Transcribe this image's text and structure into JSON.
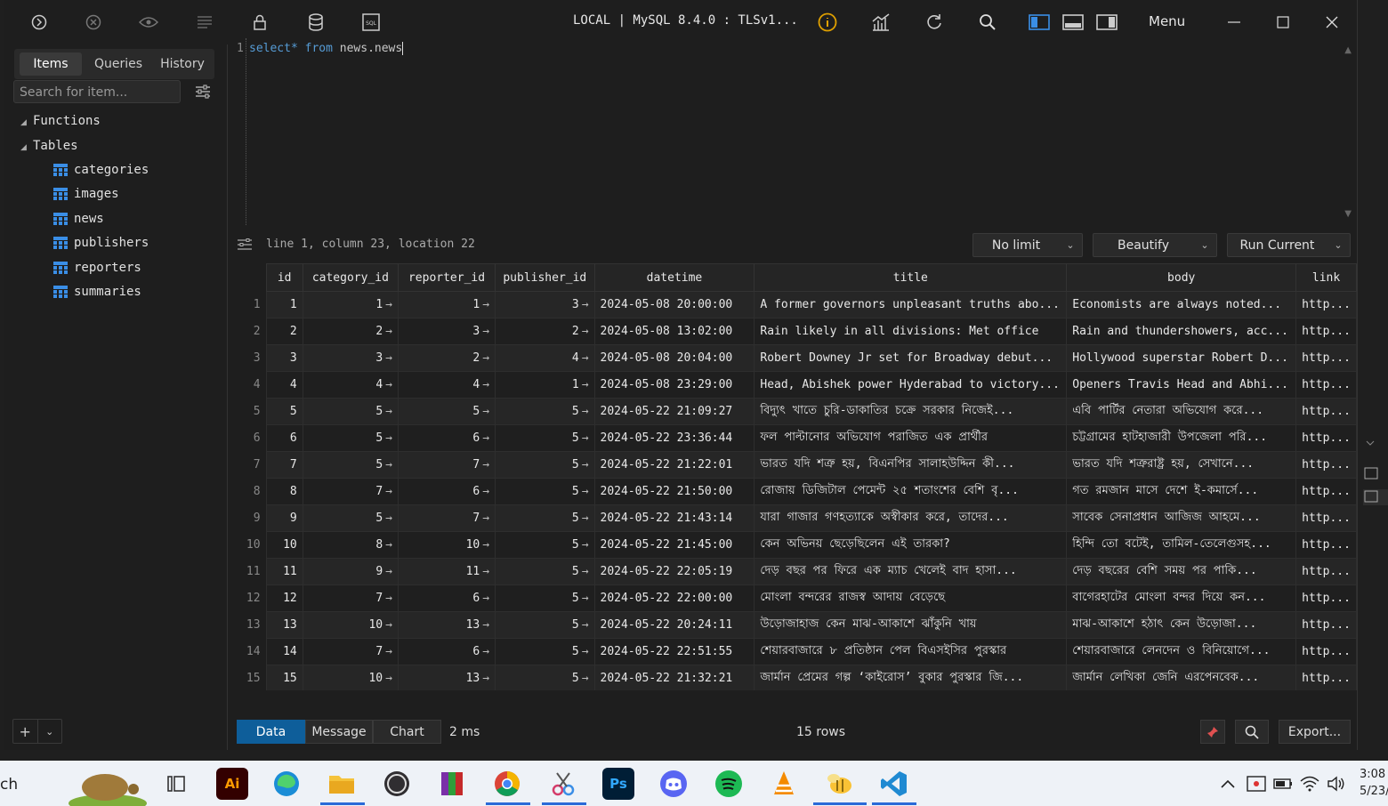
{
  "titlebar": {
    "connection": "LOCAL | MySQL 8.4.0 : TLSv1...",
    "menu_label": "Menu"
  },
  "sidebar": {
    "tabs": [
      "Items",
      "Queries",
      "History"
    ],
    "search_placeholder": "Search for item...",
    "groups": {
      "functions": "Functions",
      "tables": "Tables"
    },
    "tables": [
      "categories",
      "images",
      "news",
      "publishers",
      "reporters",
      "summaries"
    ]
  },
  "editor": {
    "line_number": "1",
    "code_keyword1": "select*",
    "code_keyword2": "from",
    "code_ident": "news.news"
  },
  "status": {
    "position": "line 1, column 23, location 22",
    "limit": "No limit",
    "beautify": "Beautify",
    "run": "Run Current"
  },
  "grid": {
    "columns": [
      "id",
      "category_id",
      "reporter_id",
      "publisher_id",
      "datetime",
      "title",
      "body",
      "link"
    ],
    "rows": [
      [
        "1",
        "1",
        "1",
        "3",
        "2024-05-08 20:00:00",
        "A former governors unpleasant truths abo...",
        "Economists are always noted...",
        "http..."
      ],
      [
        "2",
        "2",
        "3",
        "2",
        "2024-05-08 13:02:00",
        "Rain likely in all divisions: Met office",
        "Rain and thundershowers, acc...",
        "http..."
      ],
      [
        "3",
        "3",
        "2",
        "4",
        "2024-05-08 20:04:00",
        "Robert Downey Jr set for Broadway debut...",
        "Hollywood superstar Robert D...",
        "http..."
      ],
      [
        "4",
        "4",
        "4",
        "1",
        "2024-05-08 23:29:00",
        "Head, Abishek power Hyderabad to victory...",
        "Openers Travis Head and Abhi...",
        "http..."
      ],
      [
        "5",
        "5",
        "5",
        "5",
        "2024-05-22 21:09:27",
        "বিদ্যুৎ খাতে চুরি-ডাকাতির চক্রে সরকার নিজেই...",
        "এবি পার্টির নেতারা অভিযোগ করে...",
        "http..."
      ],
      [
        "6",
        "5",
        "6",
        "5",
        "2024-05-22 23:36:44",
        "ফল পাল্টানোর অভিযোগ পরাজিত এক প্রার্থীর",
        "চট্টগ্রামের হাটহাজারী উপজেলা পরি...",
        "http..."
      ],
      [
        "7",
        "5",
        "7",
        "5",
        "2024-05-22 21:22:01",
        "ভারত যদি শত্রু হয়, বিএনপির সালাহউদ্দিন কী...",
        "ভারত যদি শত্রুরাষ্ট্র হয়, সেখানে...",
        "http..."
      ],
      [
        "8",
        "7",
        "6",
        "5",
        "2024-05-22 21:50:00",
        "রোজায় ডিজিটাল পেমেন্ট ২৫ শতাংশের বেশি বৃ...",
        "গত রমজান মাসে দেশে ই-কমার্সে...",
        "http..."
      ],
      [
        "9",
        "5",
        "7",
        "5",
        "2024-05-22 21:43:14",
        "যারা গাজার গণহত্যাকে অস্বীকার করে, তাদের...",
        "সাবেক সেনাপ্রধান আজিজ আহমে...",
        "http..."
      ],
      [
        "10",
        "8",
        "10",
        "5",
        "2024-05-22 21:45:00",
        "কেন অভিনয় ছেড়েছিলেন এই তারকা?",
        "হিন্দি তো বটেই, তামিল-তেলেগুসহ...",
        "http..."
      ],
      [
        "11",
        "9",
        "11",
        "5",
        "2024-05-22 22:05:19",
        "দেড় বছর পর ফিরে এক ম্যাচ খেলেই বাদ হাসা...",
        "দেড় বছরের বেশি সময় পর পাকি...",
        "http..."
      ],
      [
        "12",
        "7",
        "6",
        "5",
        "2024-05-22 22:00:00",
        "মোংলা বন্দরের রাজস্ব আদায় বেড়েছে",
        "বাগেরহাটের মোংলা বন্দর দিয়ে কন...",
        "http..."
      ],
      [
        "13",
        "10",
        "13",
        "5",
        "2024-05-22 20:24:11",
        "উড়োজাহাজ কেন মাঝ-আকাশে ঝাঁকুনি খায়",
        "মাঝ-আকাশে হঠাৎ কেন উড়োজা...",
        "http..."
      ],
      [
        "14",
        "7",
        "6",
        "5",
        "2024-05-22 22:51:55",
        "শেয়ারবাজারে ৮ প্রতিষ্ঠান পেল বিএসইসির পুরস্কার",
        "শেয়ারবাজারে লেনদেন ও বিনিয়োগে...",
        "http..."
      ],
      [
        "15",
        "10",
        "13",
        "5",
        "2024-05-22 21:32:21",
        "জার্মান প্রেমের গল্প ‘কাইরোস’ বুকার পুরস্কার জি...",
        "জার্মান লেখিকা জেনি এরপেনবেক...",
        "http..."
      ]
    ]
  },
  "bottom": {
    "tabs": [
      "Data",
      "Message",
      "Chart"
    ],
    "elapsed": "2 ms",
    "row_count": "15 rows",
    "export_label": "Export..."
  },
  "taskbar": {
    "search_text": "ch",
    "time": "3:08",
    "date": "5/23/"
  },
  "colors": {
    "accent": "#0e5e9a",
    "keyword": "#569cd6",
    "table_icon": "#3a8ee6",
    "info_icon": "#e0a000"
  }
}
